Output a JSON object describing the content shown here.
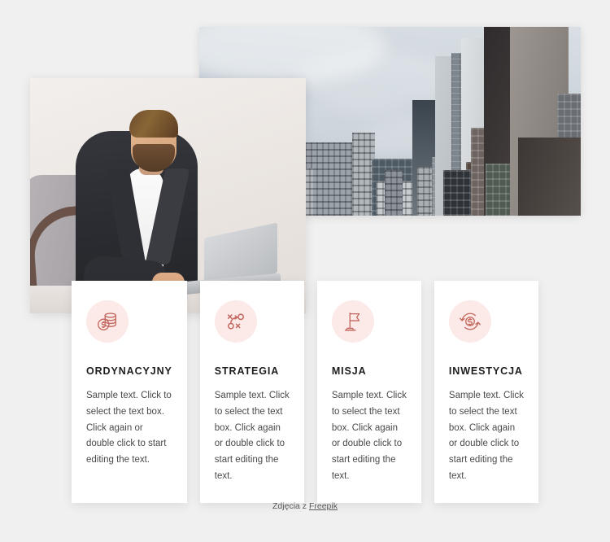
{
  "background_color": "#f0f0f0",
  "accent_color": "#c4675e",
  "icon_bg_color": "#fbeae7",
  "photos": [
    {
      "name": "city-skyline",
      "alt": "Cloudy sky over modern city skyscrapers"
    },
    {
      "name": "businessman-laptop",
      "alt": "Bearded businessman in dark blazer working on a laptop"
    }
  ],
  "cards": [
    {
      "icon": "coins-stack-icon",
      "title": "ORDYNACYJNY",
      "text": "Sample text. Click to select the text box. Click again or double click to start editing the text."
    },
    {
      "icon": "strategy-tactics-icon",
      "title": "STRATEGIA",
      "text": "Sample text. Click to select the text box. Click again or double click to start editing the text."
    },
    {
      "icon": "flag-icon",
      "title": "MISJA",
      "text": "Sample text. Click to select the text box. Click again or double click to start editing the text."
    },
    {
      "icon": "money-refresh-icon",
      "title": "INWESTYCJA",
      "text": "Sample text. Click to select the text box. Click again or double click to start editing the text."
    }
  ],
  "footer": {
    "prefix": "Zdjęcia z ",
    "link_label": "Freepik"
  }
}
